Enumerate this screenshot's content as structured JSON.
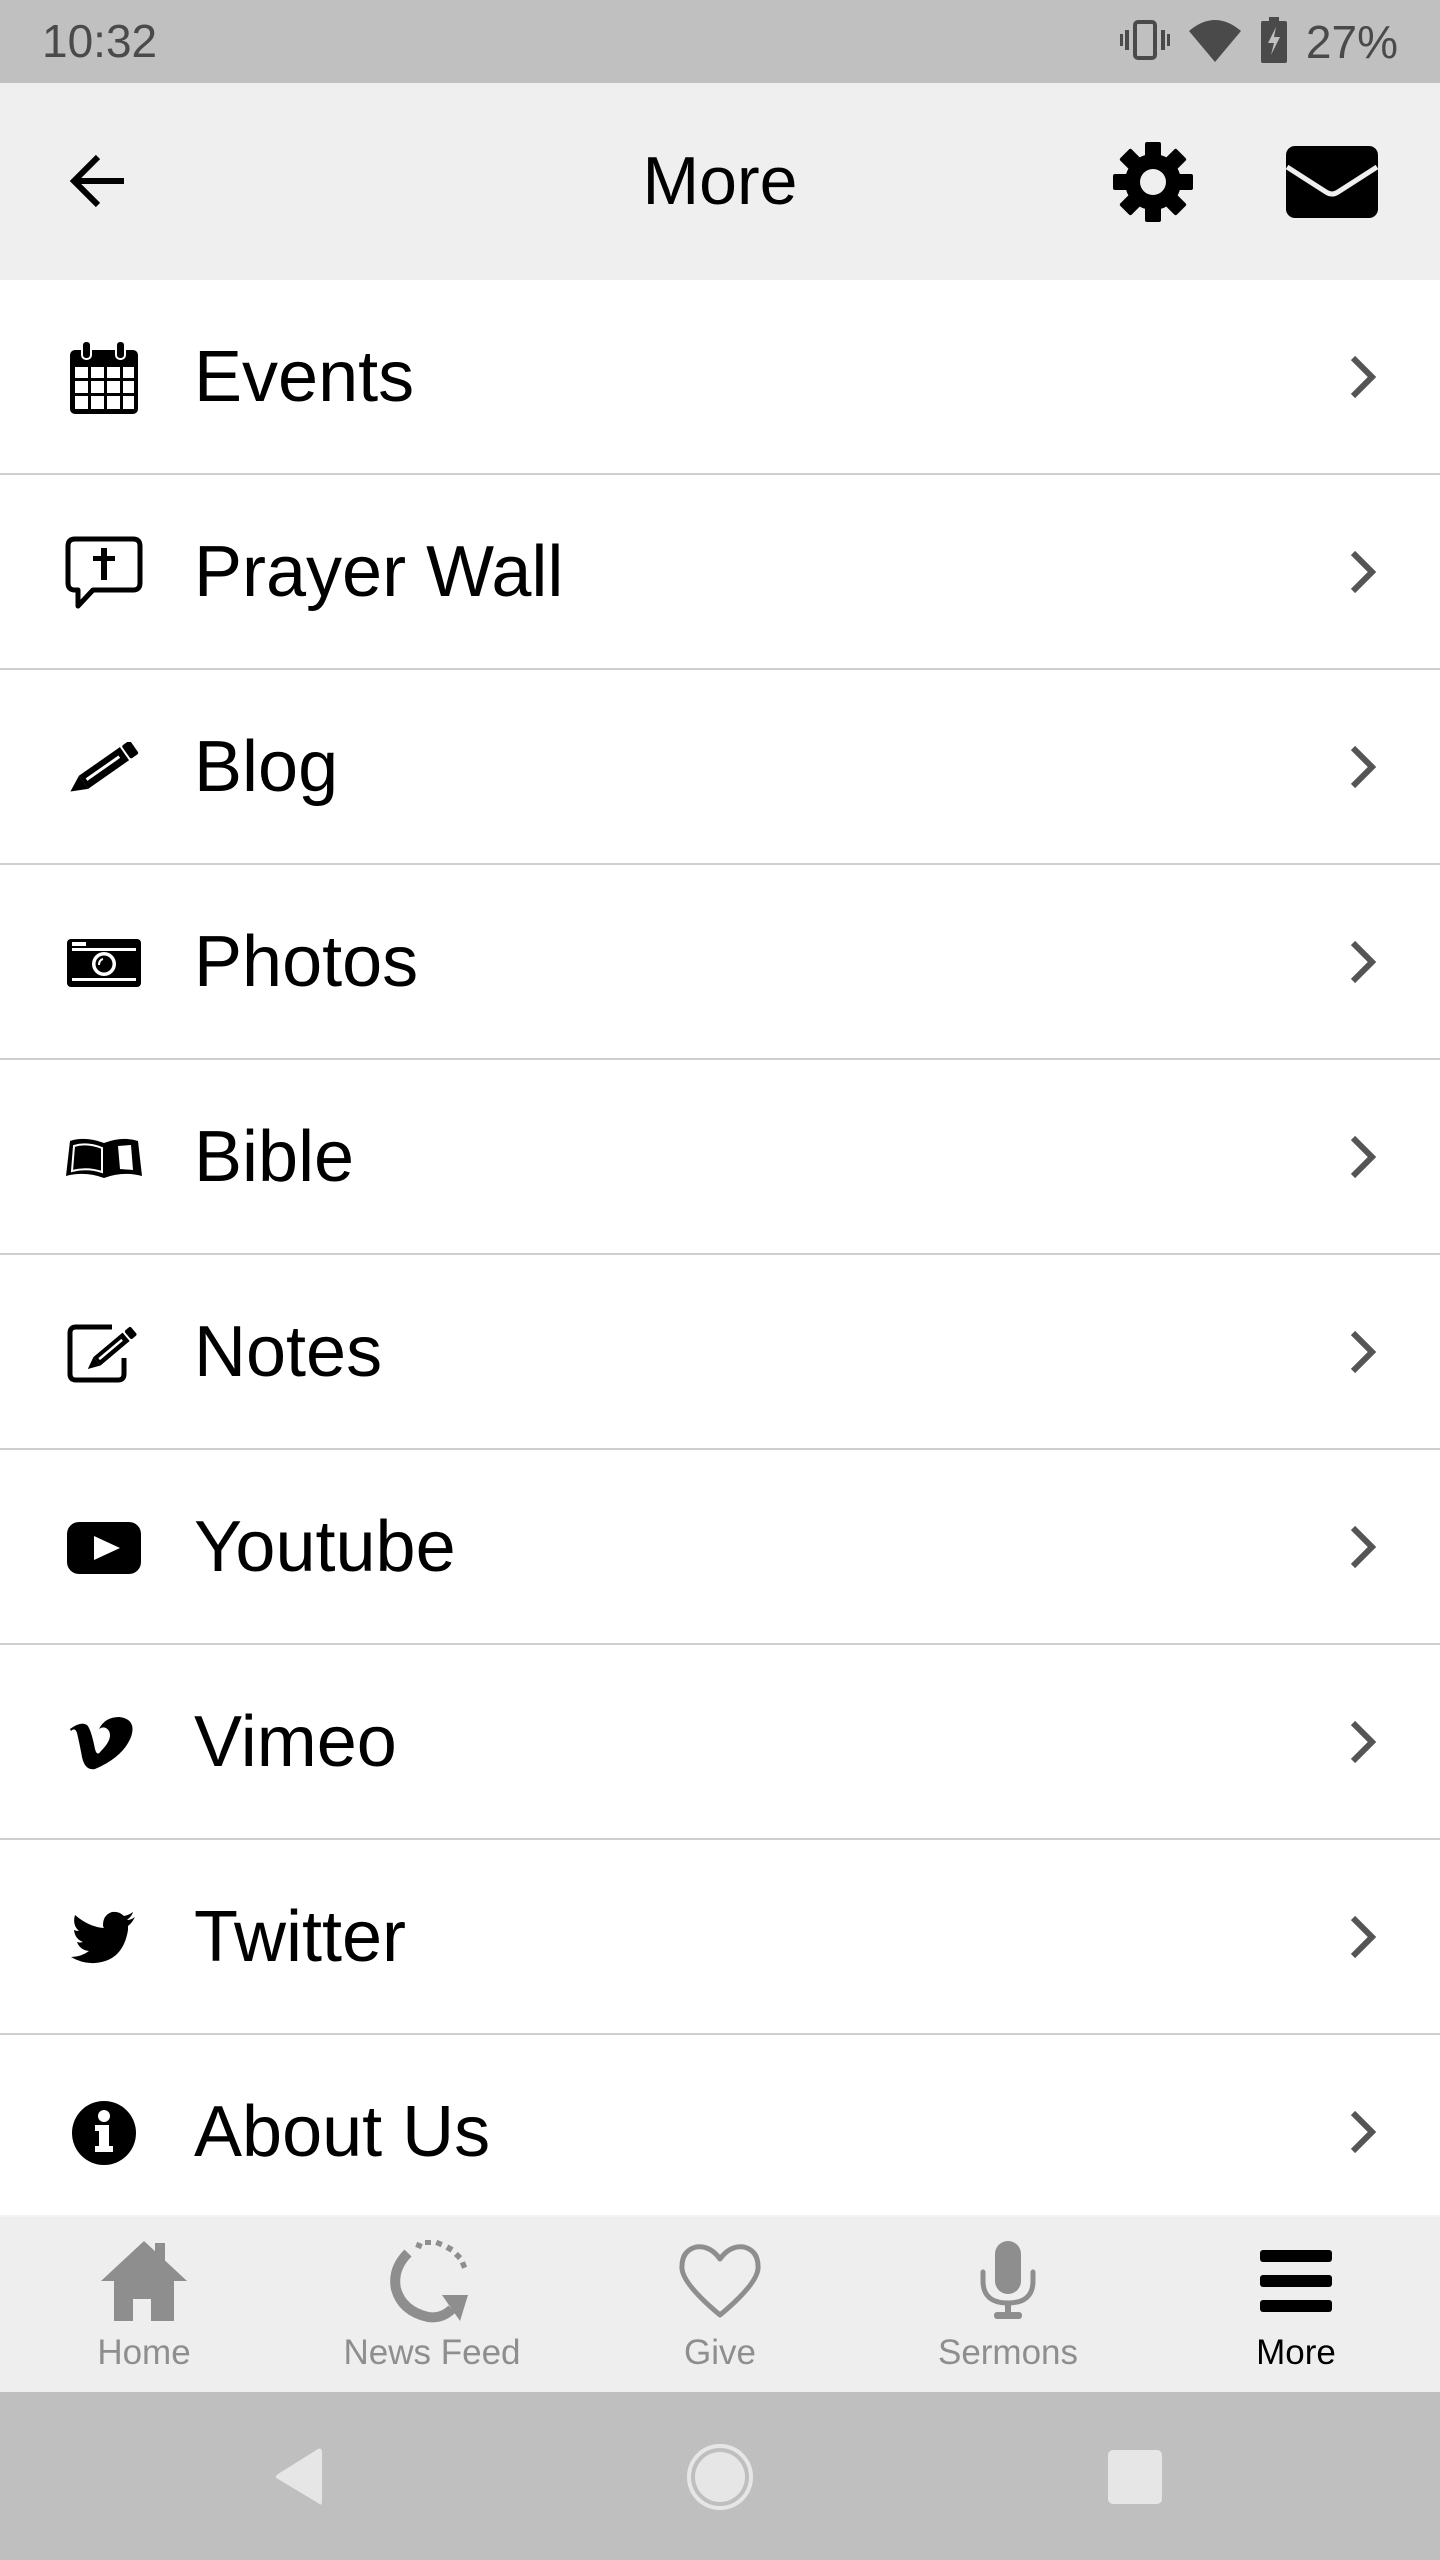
{
  "status_bar": {
    "time": "10:32",
    "battery_percent": "27%",
    "icons": [
      "vibrate-icon",
      "wifi-icon",
      "battery-charging-icon"
    ]
  },
  "app_bar": {
    "title": "More",
    "back_icon": "arrow-left-icon",
    "actions": [
      "gear-icon",
      "envelope-icon"
    ]
  },
  "menu": {
    "items": [
      {
        "label": "Events",
        "icon": "calendar-icon"
      },
      {
        "label": "Prayer Wall",
        "icon": "prayer-bubble-icon"
      },
      {
        "label": "Blog",
        "icon": "pencil-icon"
      },
      {
        "label": "Photos",
        "icon": "camera-icon"
      },
      {
        "label": "Bible",
        "icon": "book-icon"
      },
      {
        "label": "Notes",
        "icon": "edit-note-icon"
      },
      {
        "label": "Youtube",
        "icon": "youtube-icon"
      },
      {
        "label": "Vimeo",
        "icon": "vimeo-icon"
      },
      {
        "label": "Twitter",
        "icon": "twitter-icon"
      },
      {
        "label": "About Us",
        "icon": "info-icon"
      }
    ]
  },
  "tab_bar": {
    "tabs": [
      {
        "label": "Home",
        "icon": "home-icon",
        "active": false
      },
      {
        "label": "News Feed",
        "icon": "refresh-icon",
        "active": false
      },
      {
        "label": "Give",
        "icon": "heart-icon",
        "active": false
      },
      {
        "label": "Sermons",
        "icon": "microphone-icon",
        "active": false
      },
      {
        "label": "More",
        "icon": "hamburger-icon",
        "active": true
      }
    ],
    "colors": {
      "inactive": "#8e8e8e",
      "active": "#000000"
    }
  },
  "system_nav": {
    "buttons": [
      "back",
      "home",
      "recents"
    ]
  }
}
